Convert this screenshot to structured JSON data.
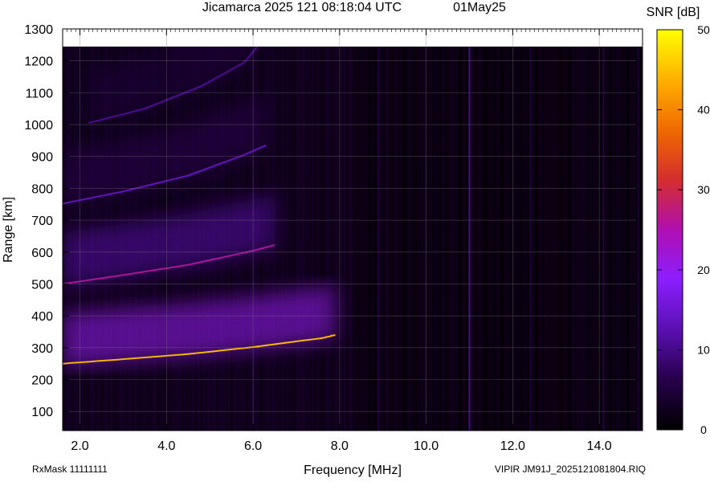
{
  "chart_data": {
    "type": "heatmap",
    "title": "Jicamarca 2025 121 08:18:04 UTC",
    "date_label": "01May25",
    "xlabel": "Frequency [MHz]",
    "ylabel": "Range [km]",
    "xlim": [
      1.6,
      15.0
    ],
    "ylim": [
      40,
      1300
    ],
    "data_ylim": [
      40,
      1245
    ],
    "x_ticks": [
      2.0,
      4.0,
      6.0,
      8.0,
      10.0,
      12.0,
      14.0
    ],
    "x_tick_labels": [
      "2.0",
      "4.0",
      "6.0",
      "8.0",
      "10.0",
      "12.0",
      "14.0"
    ],
    "y_ticks": [
      100,
      200,
      300,
      400,
      500,
      600,
      700,
      800,
      900,
      1000,
      1100,
      1200,
      1300
    ],
    "y_tick_labels": [
      "100",
      "200",
      "300",
      "400",
      "500",
      "600",
      "700",
      "800",
      "900",
      "1000",
      "1100",
      "1200",
      "1300"
    ],
    "grid": true,
    "colorbar": {
      "label": "SNR [dB]",
      "min": 0,
      "max": 50,
      "ticks": [
        0,
        10,
        20,
        30,
        40,
        50
      ],
      "tick_labels": [
        "0",
        "10",
        "20",
        "30",
        "40",
        "50"
      ],
      "colormap": [
        "#000000",
        "#26004a",
        "#5a10b0",
        "#8a1fff",
        "#b00fb0",
        "#d42e2e",
        "#ef6a00",
        "#ffb000",
        "#ffff00"
      ]
    },
    "echo_traces": [
      {
        "name": "1-hop trace",
        "points": [
          [
            1.6,
            250
          ],
          [
            3.0,
            264
          ],
          [
            4.5,
            280
          ],
          [
            6.0,
            302
          ],
          [
            7.0,
            320
          ],
          [
            7.6,
            330
          ],
          [
            7.9,
            340
          ]
        ],
        "peak_snr": 45
      },
      {
        "name": "2-hop trace",
        "points": [
          [
            1.6,
            500
          ],
          [
            3.0,
            528
          ],
          [
            4.5,
            560
          ],
          [
            6.0,
            604
          ],
          [
            6.5,
            622
          ]
        ],
        "peak_snr": 26
      },
      {
        "name": "3-hop trace",
        "points": [
          [
            1.6,
            752
          ],
          [
            3.0,
            790
          ],
          [
            4.5,
            840
          ],
          [
            5.8,
            905
          ],
          [
            6.3,
            935
          ]
        ],
        "peak_snr": 14
      },
      {
        "name": "4-hop trace",
        "points": [
          [
            2.2,
            1005
          ],
          [
            3.5,
            1050
          ],
          [
            4.8,
            1120
          ],
          [
            5.8,
            1195
          ],
          [
            6.1,
            1245
          ]
        ],
        "peak_snr": 11
      }
    ],
    "interference_lines": [
      {
        "freq": 8.9,
        "snr": 6
      },
      {
        "freq": 9.1,
        "snr": 4
      },
      {
        "freq": 11.0,
        "snr": 12
      },
      {
        "freq": 12.4,
        "snr": 5
      },
      {
        "freq": 14.1,
        "snr": 7
      },
      {
        "freq": 14.9,
        "snr": 6
      }
    ]
  },
  "footer": {
    "rxmask": "RxMask 11111111",
    "file_info": "VIPIR  JM91J_2025121081804.RIQ"
  }
}
